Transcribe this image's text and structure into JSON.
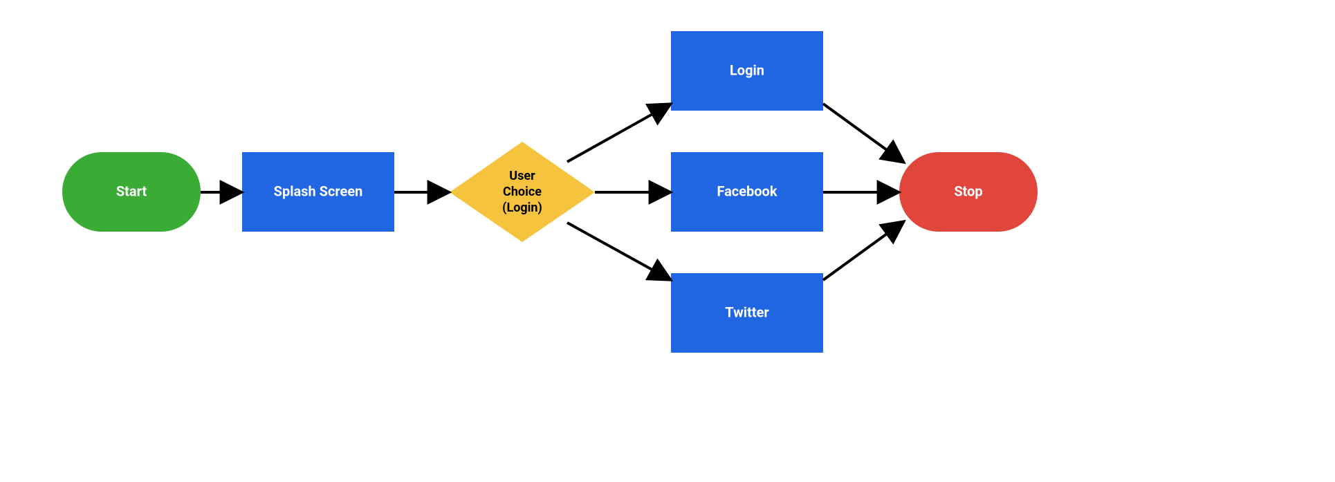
{
  "colors": {
    "start": "#3AAB35",
    "process": "#2066E3",
    "decision": "#F6C33E",
    "stop": "#E1463D",
    "edge": "#000000"
  },
  "nodes": {
    "start": {
      "label": "Start"
    },
    "splash": {
      "label": "Splash Screen"
    },
    "decision": {
      "line1": "User",
      "line2": "Choice",
      "line3": "(Login)"
    },
    "login": {
      "label": "Login"
    },
    "facebook": {
      "label": "Facebook"
    },
    "twitter": {
      "label": "Twitter"
    },
    "stop": {
      "label": "Stop"
    }
  }
}
